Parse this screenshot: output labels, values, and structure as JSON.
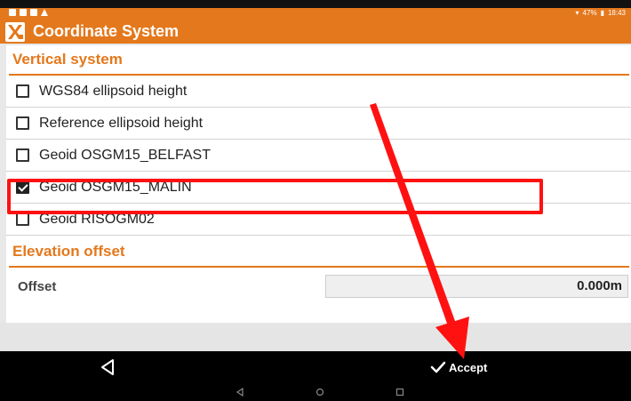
{
  "status_bar": {
    "time": "18:43",
    "battery": "47%",
    "notification_icons": [
      "image-icon",
      "image-icon",
      "image-icon",
      "warning-icon"
    ]
  },
  "app_bar": {
    "title": "Coordinate System",
    "logo_icon": "app-logo-icon"
  },
  "vertical_system": {
    "header": "Vertical system",
    "options": [
      {
        "label": "WGS84 ellipsoid height",
        "checked": false
      },
      {
        "label": "Reference ellipsoid height",
        "checked": false
      },
      {
        "label": "Geoid OSGM15_BELFAST",
        "checked": false
      },
      {
        "label": "Geoid OSGM15_MALIN",
        "checked": true
      },
      {
        "label": "Geoid RISOGM02",
        "checked": false
      }
    ]
  },
  "elevation_offset": {
    "header": "Elevation offset",
    "offset_label": "Offset",
    "offset_value": "0.000m"
  },
  "action_bar": {
    "back_icon": "back-triangle-icon",
    "accept_label": "Accept",
    "accept_icon": "checkmark-icon"
  },
  "nav_bar": {
    "icons": [
      "nav-back-icon",
      "nav-home-icon",
      "nav-recents-icon"
    ]
  },
  "colors": {
    "accent": "#e4781c",
    "annotation_red": "#ff1111"
  }
}
